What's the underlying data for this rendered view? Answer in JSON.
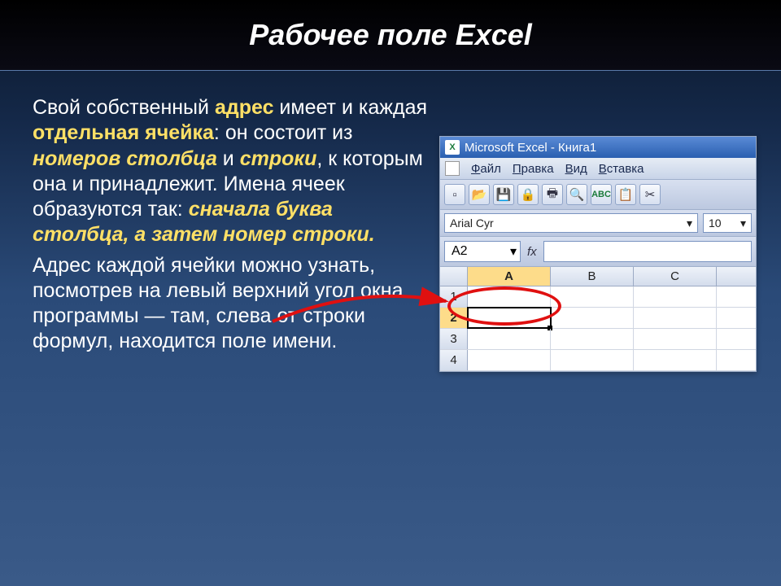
{
  "slide": {
    "title": "Рабочее поле Excel",
    "paragraph1": {
      "t1": "Свой собственный ",
      "address": "адрес",
      "t2": " имеет и каждая ",
      "cell": "отдельная ячейка",
      "t3": ": он состоит из ",
      "col_num": "номеров столбца",
      "t4": " и ",
      "row": "строки",
      "t5": ", к которым она и принадлежит. Имена ячеек образуются так: ",
      "rule": "сначала буква столбца, а затем номер строки."
    },
    "paragraph2": "Адрес каждой ячейки можно узнать, посмотрев на левый верхний угол окна программы — там, слева от строки формул, находится поле имени."
  },
  "excel": {
    "title": "Microsoft Excel - Книга1",
    "menus": [
      "Файл",
      "Правка",
      "Вид",
      "Вставка"
    ],
    "menu_underlines": [
      "Ф",
      "П",
      "В",
      "В"
    ],
    "font_name": "Arial Cyr",
    "font_size": "10",
    "name_box": "A2",
    "fx_label": "fx",
    "columns": [
      "A",
      "B",
      "C"
    ],
    "rows": [
      "1",
      "2",
      "3",
      "4"
    ],
    "active_col": "A",
    "active_row": "2",
    "toolbar_icons": [
      "new",
      "open",
      "save",
      "permission",
      "print",
      "preview",
      "spelling",
      "research",
      "cut"
    ]
  }
}
